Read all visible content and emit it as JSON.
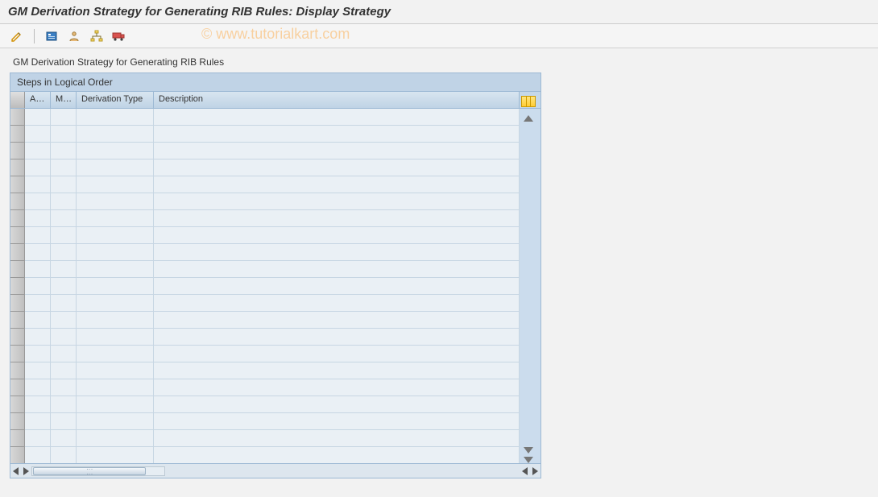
{
  "window": {
    "title": "GM Derivation Strategy for Generating RIB Rules: Display Strategy"
  },
  "toolbar": {
    "icons": [
      "pencil-icon",
      "detail-icon",
      "user-icon",
      "hierarchy-icon",
      "transport-icon"
    ]
  },
  "section": {
    "label": "GM Derivation Strategy for Generating RIB Rules"
  },
  "table": {
    "title": "Steps in Logical Order",
    "columns": {
      "ac": "Ac...",
      "ma": "Ma...",
      "deriv": "Derivation Type",
      "desc": "Description"
    },
    "rows": 21
  },
  "watermark": "© www.tutorialkart.com"
}
